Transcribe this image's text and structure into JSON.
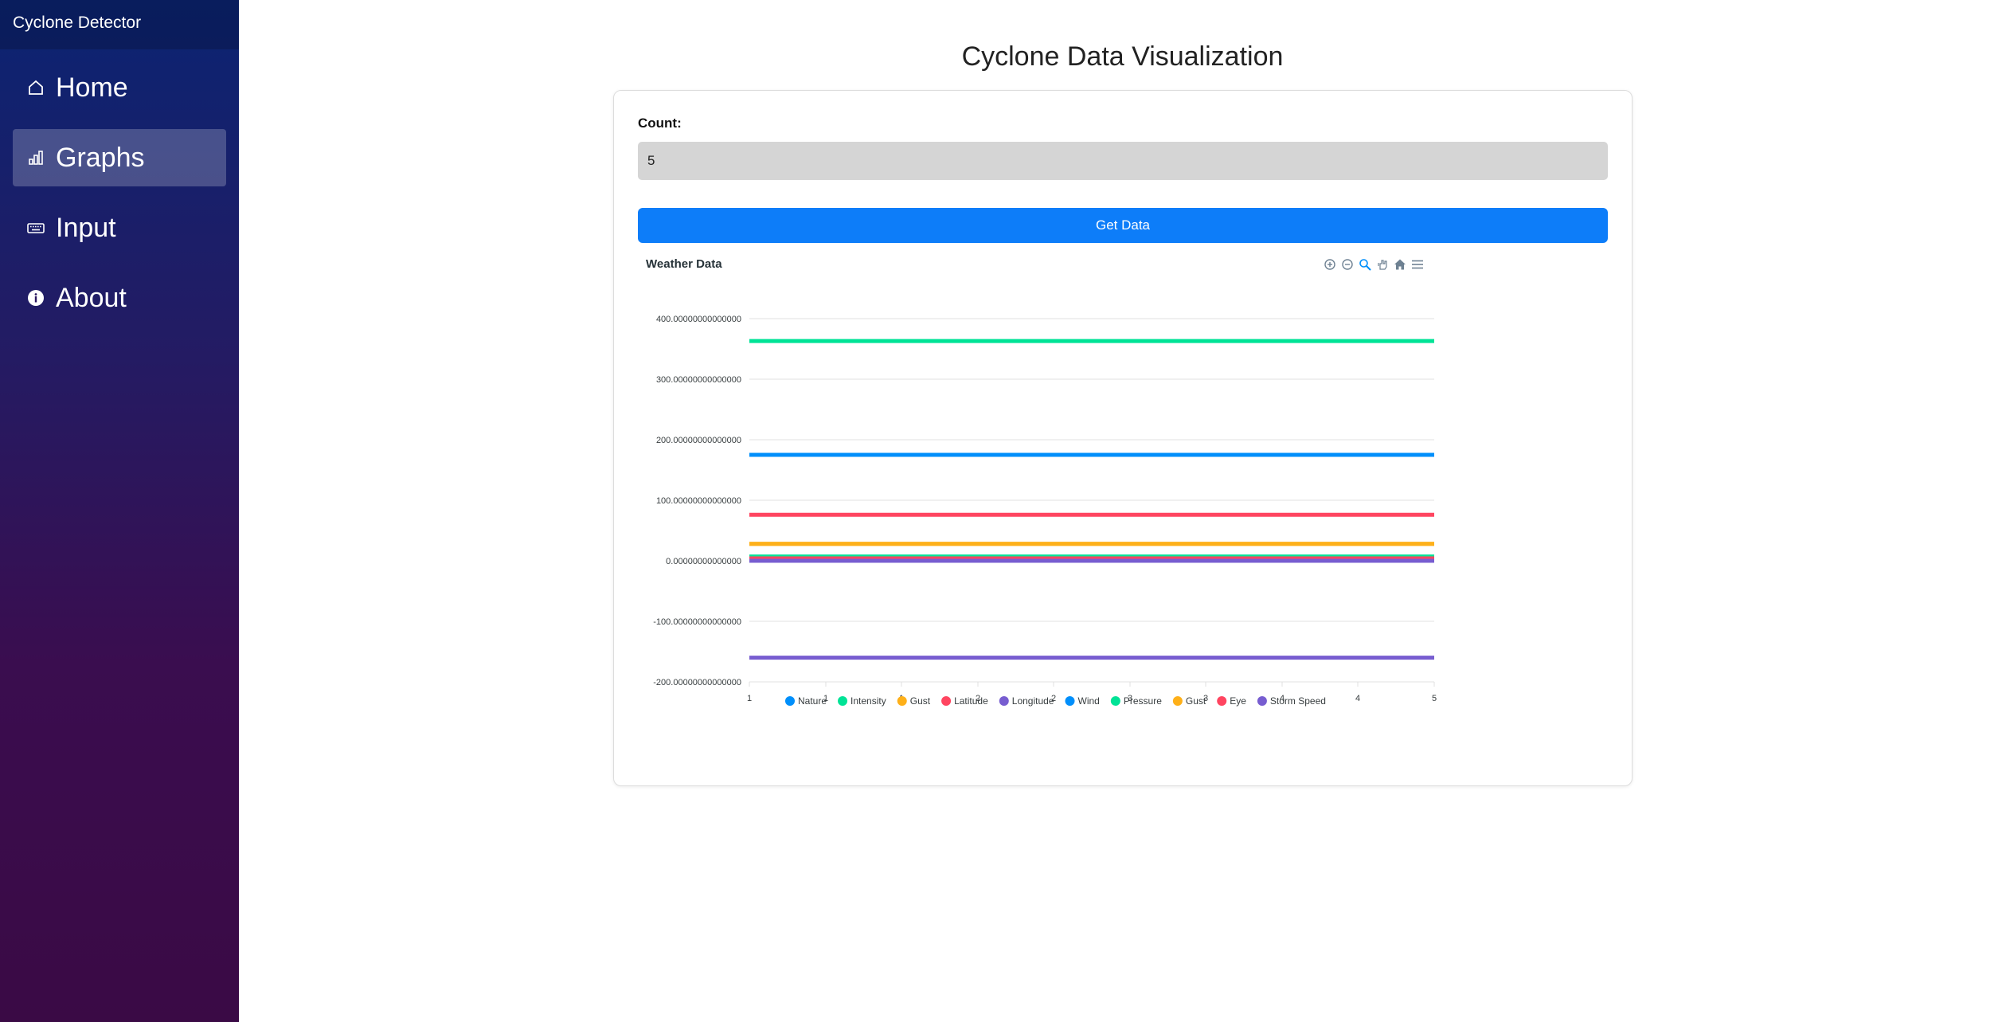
{
  "app": {
    "title": "Cyclone Detector"
  },
  "sidebar": {
    "items": [
      {
        "label": "Home",
        "icon": "home-icon"
      },
      {
        "label": "Graphs",
        "icon": "bar-chart-icon",
        "active": true
      },
      {
        "label": "Input",
        "icon": "keyboard-icon"
      },
      {
        "label": "About",
        "icon": "info-icon"
      }
    ]
  },
  "main": {
    "title": "Cyclone Data Visualization",
    "count_label": "Count:",
    "count_value": "5",
    "button_label": "Get Data"
  },
  "toolbar": {
    "icons": [
      "zoom-in-icon",
      "zoom-out-icon",
      "selection-zoom-icon",
      "pan-icon",
      "reset-home-icon",
      "menu-icon"
    ]
  },
  "chart_data": {
    "type": "line",
    "title": "Weather Data",
    "x_tick_labels": [
      "1",
      "1",
      "1",
      "2",
      "2",
      "3",
      "3",
      "4",
      "4",
      "5"
    ],
    "y_tick_labels": [
      "400.00000000000000",
      "300.00000000000000",
      "200.00000000000000",
      "100.00000000000000",
      "0.00000000000000",
      "-100.00000000000000",
      "-200.00000000000000"
    ],
    "ylim": [
      -200,
      400
    ],
    "xlim": [
      1,
      5
    ],
    "grid": true,
    "legend_position": "bottom",
    "series": [
      {
        "name": "Nature",
        "color": "#008ffb",
        "values": [
          2,
          2,
          2,
          2,
          2
        ]
      },
      {
        "name": "Intensity",
        "color": "#00e396",
        "values": [
          7,
          7,
          7,
          7,
          7
        ]
      },
      {
        "name": "Gust",
        "color": "#feb019",
        "values": [
          28,
          28,
          28,
          28,
          28
        ]
      },
      {
        "name": "Latitude",
        "color": "#ff4560",
        "values": [
          76,
          76,
          76,
          76,
          76
        ]
      },
      {
        "name": "Longitude",
        "color": "#775dd0",
        "values": [
          -160,
          -160,
          -160,
          -160,
          -160
        ]
      },
      {
        "name": "Wind",
        "color": "#008ffb",
        "values": [
          175,
          175,
          175,
          175,
          175
        ]
      },
      {
        "name": "Pressure",
        "color": "#00e396",
        "values": [
          363,
          363,
          363,
          363,
          363
        ]
      },
      {
        "name": "Gust",
        "color": "#feb019",
        "values": [
          28,
          28,
          28,
          28,
          28
        ]
      },
      {
        "name": "Eye",
        "color": "#ff4560",
        "values": [
          4,
          4,
          4,
          4,
          4
        ]
      },
      {
        "name": "Storm Speed",
        "color": "#775dd0",
        "values": [
          0,
          0,
          0,
          0,
          0
        ]
      }
    ]
  }
}
